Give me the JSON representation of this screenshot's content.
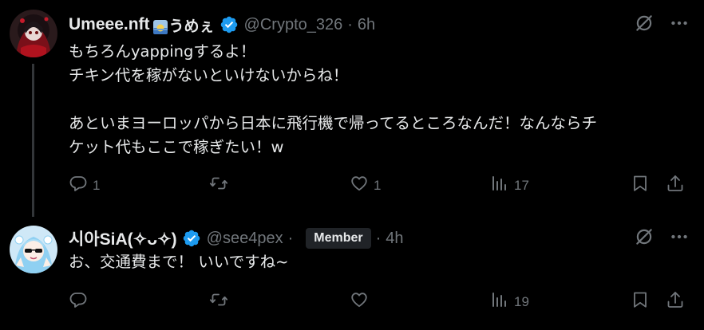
{
  "tweets": [
    {
      "display_name": "Umeee.nft",
      "display_name_suffix": "うめぇ",
      "handle": "@Crypto_326",
      "separator": "·",
      "time": "6h",
      "text": "もちろんyappingするよ！\nチキン代を稼がないといけないからね！\n\nあといまヨーロッパから日本に飛行機で帰ってるところなんだ！なんならチ\nケット代もここで稼ぎたい！w",
      "reply_count": "1",
      "retweet_count": "",
      "like_count": "1",
      "view_count": "17",
      "verified_color": "#1d9bf0"
    },
    {
      "display_name": "시아SiA(✧ᴗ✧)",
      "handle": "@see4pex",
      "separator": "·",
      "badge": "Member",
      "separator2": "·",
      "time": "4h",
      "text": "お、交通費まで！ いいですね~",
      "reply_count": "",
      "retweet_count": "",
      "like_count": "",
      "view_count": "19",
      "verified_color": "#1d9bf0"
    }
  ],
  "icons": {
    "reply": "reply-icon",
    "retweet": "retweet-icon",
    "like": "heart-icon",
    "views": "views-chart-icon",
    "bookmark": "bookmark-icon",
    "share": "share-icon",
    "grok": "grok-icon",
    "more": "more-icon"
  },
  "colors": {
    "background": "#000000",
    "text": "#e7e9ea",
    "muted": "#71767b",
    "verified": "#1d9bf0"
  }
}
